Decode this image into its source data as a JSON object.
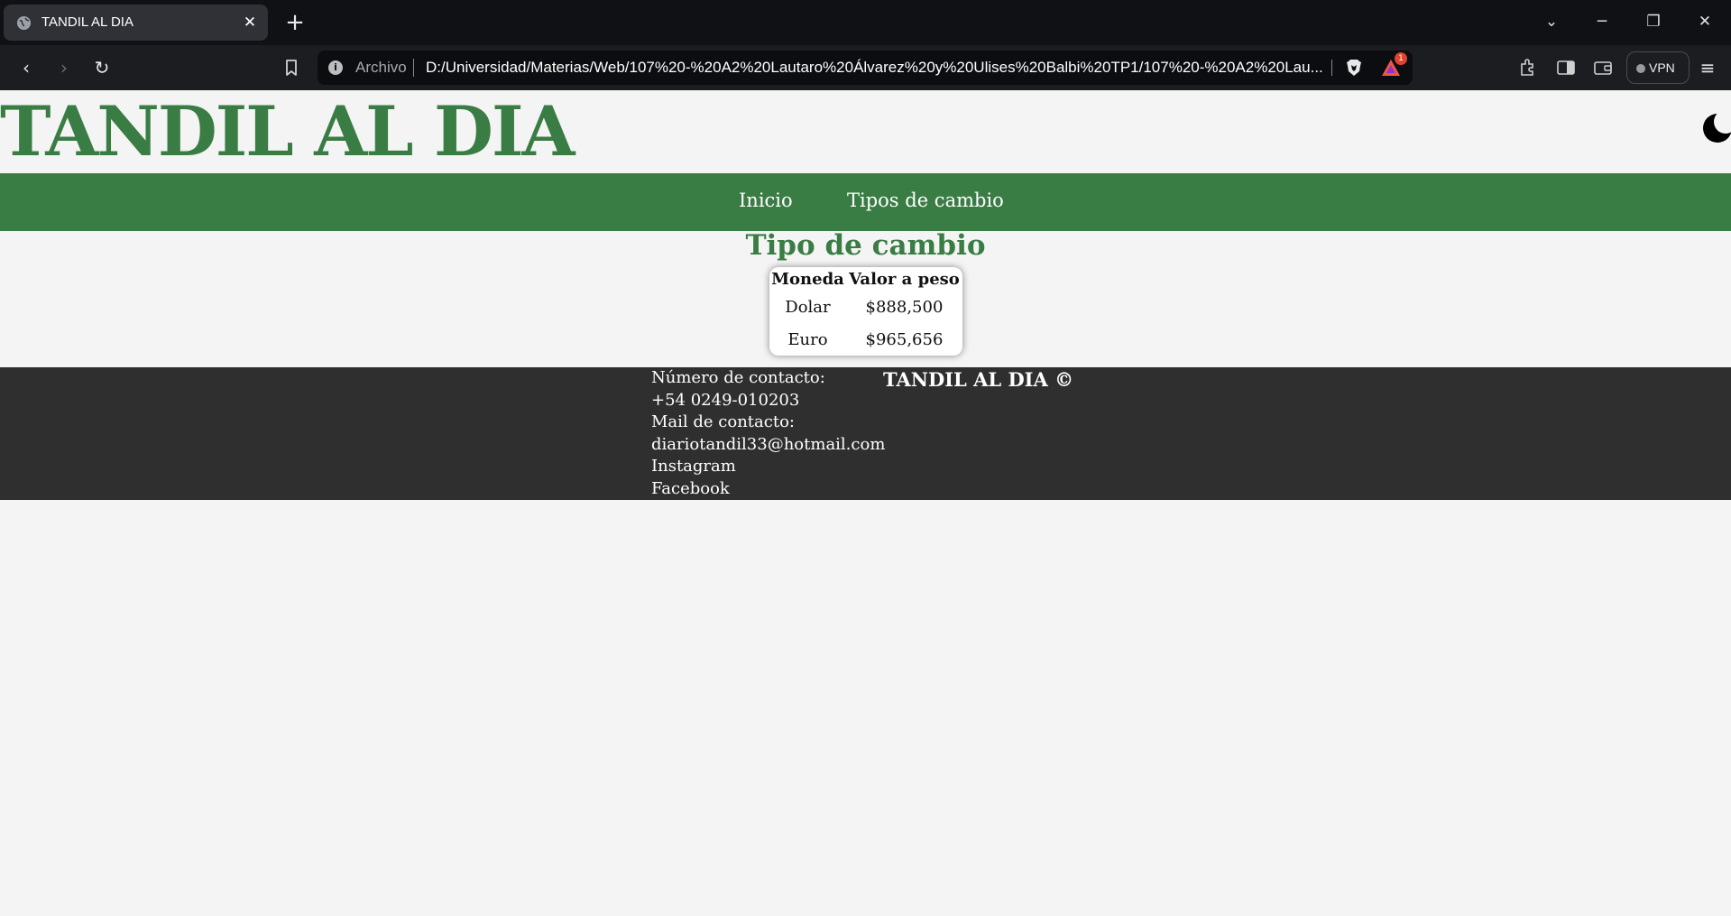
{
  "browser": {
    "tab_title": "TANDIL AL DIA",
    "tab_close": "✕",
    "new_tab": "+",
    "url_scheme": "Archivo",
    "url": "D:/Universidad/Materias/Web/107%20-%20A2%20Lautaro%20Álvarez%20y%20Ulises%20Balbi%20TP1/107%20-%20A2%20Lau...",
    "rewards_badge": "1",
    "vpn_label": "VPN",
    "back": "‹",
    "forward": "›",
    "reload": "↻",
    "menu": "≡",
    "win_dropdown": "⌄",
    "win_minimize": "─",
    "win_restore": "❐",
    "win_close": "✕",
    "info": "i"
  },
  "header": {
    "site_title": "TANDIL AL DIA",
    "theme_toggle_icon": "moon-icon"
  },
  "nav": {
    "items": [
      {
        "label": "Inicio"
      },
      {
        "label": "Tipos de cambio"
      }
    ]
  },
  "main": {
    "section_title": "Tipo de cambio",
    "table": {
      "headers": [
        "Moneda",
        "Valor a peso"
      ],
      "rows": [
        [
          "Dolar",
          "$888,500"
        ],
        [
          "Euro",
          "$965,656"
        ]
      ]
    }
  },
  "footer": {
    "contact_number_label": "Número de contacto:",
    "contact_number": "+54 0249-010203",
    "contact_mail_label": "Mail de contacto:",
    "contact_mail": "diariotandil33@hotmail.com",
    "instagram": "Instagram",
    "facebook": "Facebook",
    "brand": "TANDIL AL DIA ©"
  },
  "colors": {
    "brand_green": "#3a7d44",
    "footer_bg": "#2f2f2f",
    "page_bg": "#f4f4f4"
  }
}
